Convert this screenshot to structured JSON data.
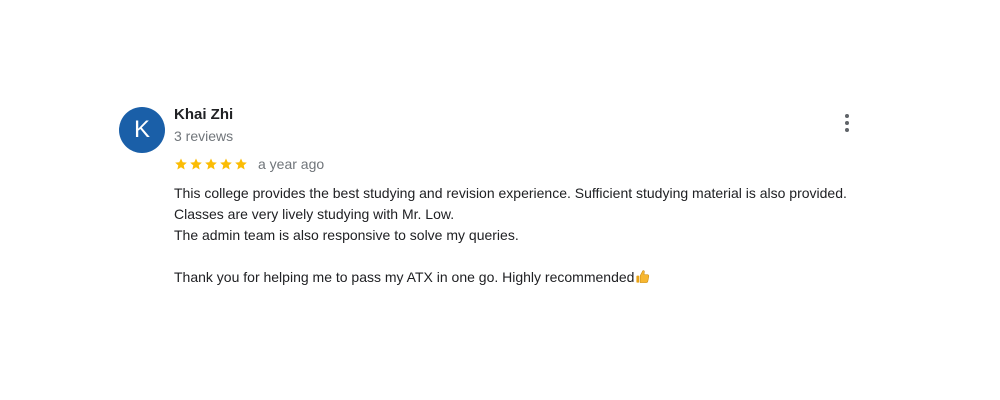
{
  "review": {
    "avatar_letter": "K",
    "avatar_color": "#1a5fa8",
    "author": "Khai Zhi",
    "review_count": "3 reviews",
    "rating": 5,
    "rating_max": 5,
    "star_color": "#fbbc04",
    "date": "a year ago",
    "body_lines": [
      "This college provides the best studying and revision experience. Sufficient studying material is also provided.",
      "Classes are very lively studying with Mr. Low.",
      "The admin team is also responsive to solve my queries.",
      "",
      "Thank you for helping me to pass my ATX in one go. Highly recommended"
    ],
    "trailing_icon": "thumbs-up-icon",
    "menu_icon": "more-vert-icon"
  }
}
